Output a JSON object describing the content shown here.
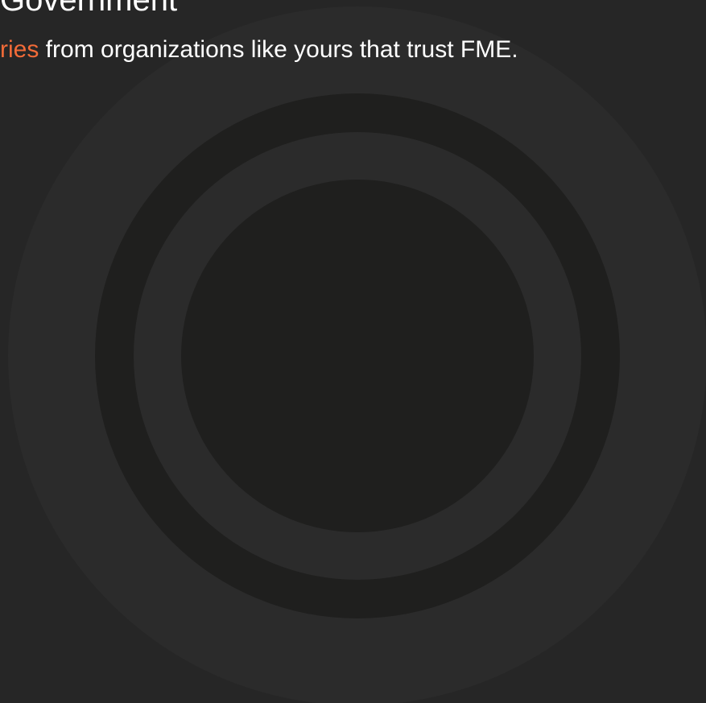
{
  "header": {
    "title": "Government",
    "subtitle_link": "ries",
    "subtitle_rest": " from organizations like yours that trust FME."
  },
  "colors": {
    "background": "#262626",
    "ring_dark": "#1f1f1e",
    "ring_light": "#2b2b2b",
    "link_accent": "#f26b38",
    "text": "#ffffff"
  }
}
